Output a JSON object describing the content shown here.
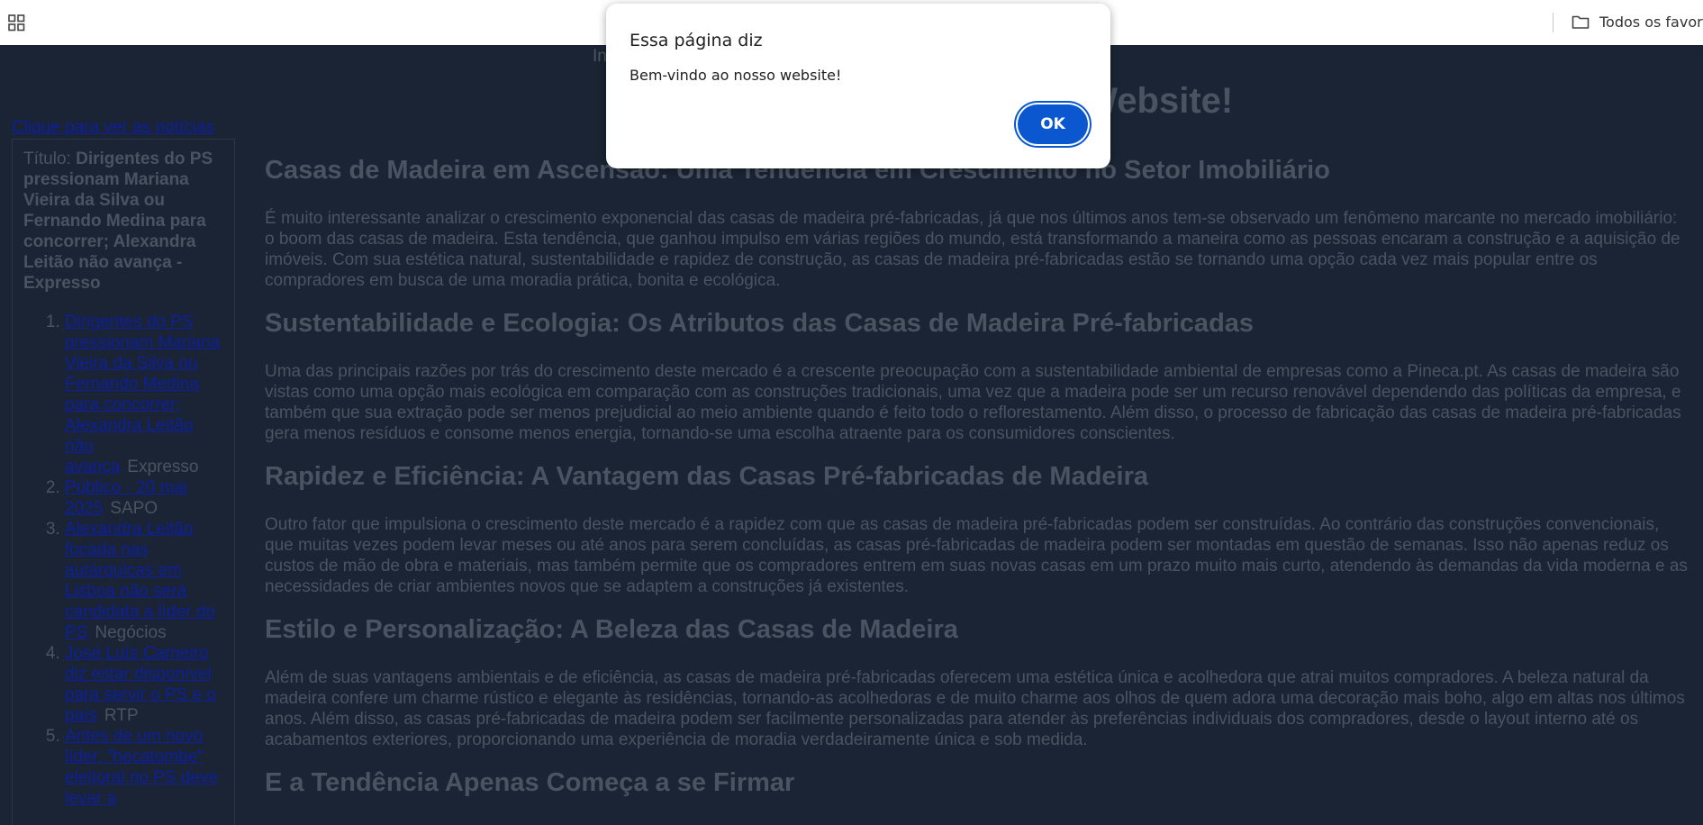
{
  "bookmarks_bar": {
    "favorites_label": "Todos os favoritos"
  },
  "dialog": {
    "title": "Essa página diz",
    "message": "Bem-vindo ao nosso website!",
    "ok_label": "OK"
  },
  "page": {
    "nav_hint": "In",
    "news_link": "Clique para ver as notícias",
    "news_panel": {
      "title_prefix": "Título:",
      "title": "Dirigentes do PS pressionam Mariana Vieira da Silva ou Fernando Medina para concorrer; Alexandra Leitão não avança - Expresso",
      "items": [
        {
          "link": "Dirigentes do PS pressionam Mariana Vieira da Silva ou Fernando Medina para concorrer; Alexandra Leitão não avança",
          "source": "Expresso"
        },
        {
          "link": "Público · 20 mai 2025",
          "source": "SAPO"
        },
        {
          "link": "Alexandra Leitão focada nas autárquicas em Lisboa não será candidata a líder do PS",
          "source": "Negócios"
        },
        {
          "link": "José Luís Carneiro diz estar disponível para servir o PS e o país",
          "source": "RTP"
        },
        {
          "link": "Antes de um novo líder, \"hecatombe\" eleitoral no PS deve levar a",
          "source": ""
        }
      ]
    },
    "site_title": "Bem-vindo ao nosso Website!",
    "article": {
      "sections": [
        {
          "heading": "Casas de Madeira em Ascensão: Uma Tendência em Crescimento no Setor Imobiliário",
          "text": "É muito interessante analizar o crescimento exponencial das casas de madeira pré-fabricadas, já que nos últimos anos tem-se observado um fenômeno marcante no mercado imobiliário: o boom das casas de madeira. Esta tendência, que ganhou impulso em várias regiões do mundo, está transformando a maneira como as pessoas encaram a construção e a aquisição de imóveis. Com sua estética natural, sustentabilidade e rapidez de construção, as casas de madeira pré-fabricadas estão se tornando uma opção cada vez mais popular entre os compradores em busca de uma moradia prática, bonita e ecológica."
        },
        {
          "heading": "Sustentabilidade e Ecologia: Os Atributos das Casas de Madeira Pré-fabricadas",
          "text": "Uma das principais razões por trás do crescimento deste mercado é a crescente preocupação com a sustentabilidade ambiental de empresas como a Pineca.pt. As casas de madeira são vistas como uma opção mais ecológica em comparação com as construções tradicionais, uma vez que a madeira pode ser um recurso renovável dependendo das políticas da empresa, e também que sua extração pode ser menos prejudicial ao meio ambiente quando é feito todo o reflorestamento. Além disso, o processo de fabricação das casas de madeira pré-fabricadas gera menos resíduos e consome menos energia, tornando-se uma escolha atraente para os consumidores conscientes."
        },
        {
          "heading": "Rapidez e Eficiência: A Vantagem das Casas Pré-fabricadas de Madeira",
          "text": "Outro fator que impulsiona o crescimento deste mercado é a rapidez com que as casas de madeira pré-fabricadas podem ser construídas. Ao contrário das construções convencionais, que muitas vezes podem levar meses ou até anos para serem concluídas, as casas pré-fabricadas de madeira podem ser montadas em questão de semanas. Isso não apenas reduz os custos de mão de obra e materiais, mas também permite que os compradores entrem em suas novas casas em um prazo muito mais curto, atendendo às demandas da vida moderna e as necessidades de criar ambientes novos que se adaptem a construções já existentes."
        },
        {
          "heading": "Estilo e Personalização: A Beleza das Casas de Madeira",
          "text": "Além de suas vantagens ambientais e de eficiência, as casas de madeira pré-fabricadas oferecem uma estética única e acolhedora que atrai muitos compradores. A beleza natural da madeira confere um charme rústico e elegante às residências, tornando-as acolhedoras e de muito charme aos olhos de quem adora uma decoração mais boho, algo em altas nos últimos anos. Além disso, as casas pré-fabricadas de madeira podem ser facilmente personalizadas para atender às preferências individuais dos compradores, desde o layout interno até os acabamentos exteriores, proporcionando uma experiência de moradia verdadeiramente única e sob medida."
        },
        {
          "heading": "E a Tendência Apenas Começa a se Firmar",
          "text": ""
        }
      ]
    }
  }
}
